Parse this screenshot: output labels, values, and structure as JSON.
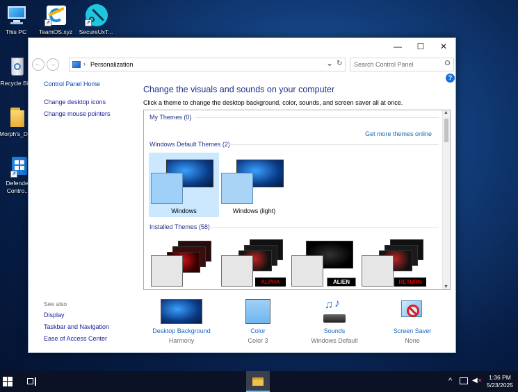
{
  "desktop": {
    "icons": [
      {
        "label": "This PC",
        "icon": "computer-icon"
      },
      {
        "label": "TeamOS.xyz",
        "icon": "edge-icon"
      },
      {
        "label": "SecureUxT...",
        "icon": "secureux-icon"
      },
      {
        "label": "Recycle Bin",
        "icon": "recycle-bin-icon"
      },
      {
        "label": "Morph's_D...",
        "icon": "folder-icon"
      },
      {
        "label": "Defender Contro...",
        "icon": "defender-icon"
      }
    ]
  },
  "window": {
    "controls": {
      "minimize": "—",
      "maximize": "☐",
      "close": "✕"
    },
    "address": {
      "breadcrumb": "Personalization",
      "back": "←",
      "forward": "→",
      "dropdown": "⌄",
      "refresh": "↻"
    },
    "search": {
      "placeholder": "Search Control Panel"
    },
    "help": "?",
    "sidebar": {
      "home": "Control Panel Home",
      "links": [
        "Change desktop icons",
        "Change mouse pointers"
      ],
      "see_also_label": "See also",
      "see_also": [
        "Display",
        "Taskbar and Navigation",
        "Ease of Access Center"
      ]
    },
    "main": {
      "heading": "Change the visuals and sounds on your computer",
      "subtext": "Click a theme to change the desktop background, color, sounds, and screen saver all at once.",
      "get_more": "Get more themes online",
      "groups": {
        "my_themes": "My Themes (0)",
        "default_themes": "Windows Default Themes (2)",
        "installed_themes": "Installed Themes (58)"
      },
      "default_themes": [
        {
          "name": "Windows",
          "selected": true
        },
        {
          "name": "Windows (light)",
          "selected": false
        }
      ],
      "installed_themes": [
        {
          "badge": ""
        },
        {
          "badge": "ALPHA"
        },
        {
          "badge": "ALIEN"
        },
        {
          "badge": "RETURN"
        }
      ]
    },
    "bottom": [
      {
        "title": "Desktop Background",
        "sub": "Harmony",
        "icon": "wallpaper-icon"
      },
      {
        "title": "Color",
        "sub": "Color 3",
        "icon": "color-swatch-icon"
      },
      {
        "title": "Sounds",
        "sub": "Windows Default",
        "icon": "sounds-icon"
      },
      {
        "title": "Screen Saver",
        "sub": "None",
        "icon": "screen-saver-icon"
      }
    ]
  },
  "taskbar": {
    "time": "1:36 PM",
    "date": "5/23/2025",
    "tray_chevron": "^"
  },
  "colors": {
    "accent": "#1565c0",
    "heading": "#1e3287",
    "selected_tile": "#cce8ff",
    "red_badge": "#d40000"
  }
}
